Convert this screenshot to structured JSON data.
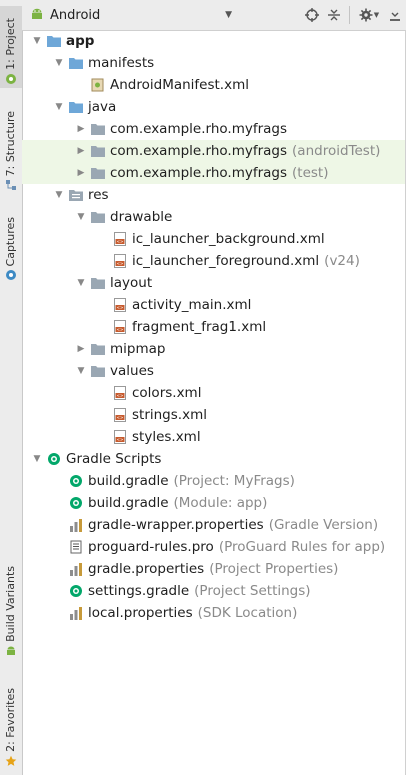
{
  "colors": {
    "folder": "#6ea7d8",
    "android": "#7cb342",
    "gradle": "#02a76a",
    "xml": "#c75b2e",
    "toolbar": "#ececec",
    "test_bg": "#eef7e6"
  },
  "toolbar": {
    "view_mode": "Android"
  },
  "left_tabs": [
    {
      "label": "1: Project",
      "icon": "project-icon"
    },
    {
      "label": "7: Structure",
      "icon": "structure-icon"
    },
    {
      "label": "Captures",
      "icon": "captures-icon"
    },
    {
      "label": "Build Variants",
      "icon": "android-icon"
    },
    {
      "label": "2: Favorites",
      "icon": "star-icon"
    }
  ],
  "tree": [
    {
      "name": "app",
      "icon": "folder",
      "expanded": true,
      "depth": 0,
      "bold": true
    },
    {
      "name": "manifests",
      "icon": "folder",
      "expanded": true,
      "depth": 1
    },
    {
      "name": "AndroidManifest.xml",
      "icon": "manifest",
      "depth": 2
    },
    {
      "name": "java",
      "icon": "folder",
      "expanded": true,
      "depth": 1
    },
    {
      "name": "com.example.rho.myfrags",
      "icon": "package",
      "expanded": false,
      "depth": 2
    },
    {
      "name": "com.example.rho.myfrags",
      "hint": "(androidTest)",
      "icon": "package",
      "expanded": false,
      "depth": 2,
      "test": true
    },
    {
      "name": "com.example.rho.myfrags",
      "hint": "(test)",
      "icon": "package",
      "expanded": false,
      "depth": 2,
      "test": true
    },
    {
      "name": "res",
      "icon": "res",
      "expanded": true,
      "depth": 1
    },
    {
      "name": "drawable",
      "icon": "package",
      "expanded": true,
      "depth": 2
    },
    {
      "name": "ic_launcher_background.xml",
      "icon": "xml",
      "depth": 3
    },
    {
      "name": "ic_launcher_foreground.xml",
      "hint": "(v24)",
      "icon": "xml",
      "depth": 3
    },
    {
      "name": "layout",
      "icon": "package",
      "expanded": true,
      "depth": 2
    },
    {
      "name": "activity_main.xml",
      "icon": "xml",
      "depth": 3
    },
    {
      "name": "fragment_frag1.xml",
      "icon": "xml",
      "depth": 3
    },
    {
      "name": "mipmap",
      "icon": "package",
      "expanded": false,
      "depth": 2
    },
    {
      "name": "values",
      "icon": "package",
      "expanded": true,
      "depth": 2
    },
    {
      "name": "colors.xml",
      "icon": "xml",
      "depth": 3
    },
    {
      "name": "strings.xml",
      "icon": "xml",
      "depth": 3
    },
    {
      "name": "styles.xml",
      "icon": "xml",
      "depth": 3
    },
    {
      "name": "Gradle Scripts",
      "icon": "gradle",
      "expanded": true,
      "depth": 0
    },
    {
      "name": "build.gradle",
      "hint": "(Project: MyFrags)",
      "icon": "gradle",
      "depth": 1
    },
    {
      "name": "build.gradle",
      "hint": "(Module: app)",
      "icon": "gradle",
      "depth": 1
    },
    {
      "name": "gradle-wrapper.properties",
      "hint": "(Gradle Version)",
      "icon": "properties",
      "depth": 1
    },
    {
      "name": "proguard-rules.pro",
      "hint": "(ProGuard Rules for app)",
      "icon": "text",
      "depth": 1
    },
    {
      "name": "gradle.properties",
      "hint": "(Project Properties)",
      "icon": "properties",
      "depth": 1
    },
    {
      "name": "settings.gradle",
      "hint": "(Project Settings)",
      "icon": "gradle",
      "depth": 1
    },
    {
      "name": "local.properties",
      "hint": "(SDK Location)",
      "icon": "properties",
      "depth": 1
    }
  ]
}
